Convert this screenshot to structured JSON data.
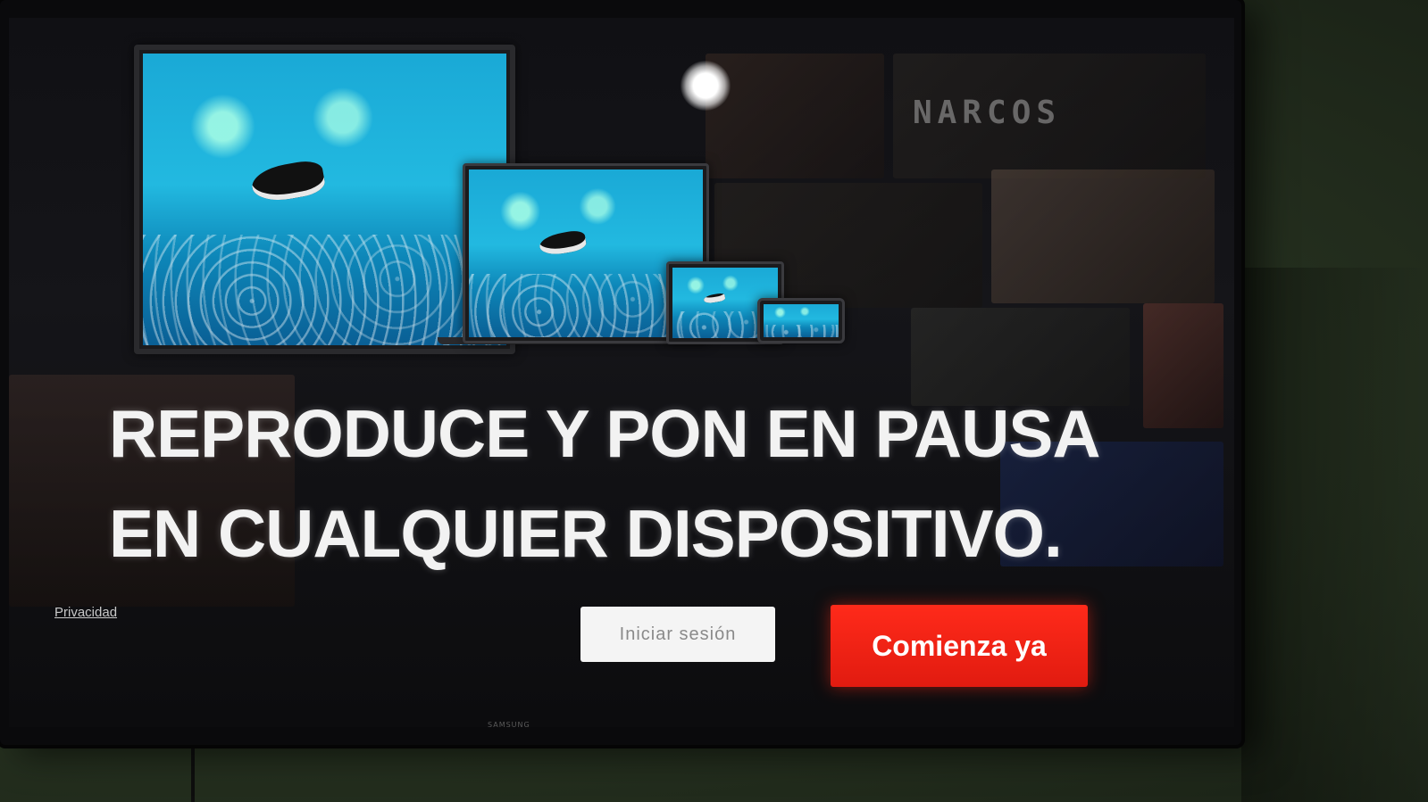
{
  "background_posters": {
    "narcos_title": "NARCOS"
  },
  "headline": {
    "line1": "REPRODUCE Y PON EN PAUSA",
    "line2": "EN CUALQUIER DISPOSITIVO."
  },
  "footer": {
    "privacy_link": "Privacidad",
    "signin_button": "Iniciar sesión",
    "start_button": "Comienza ya"
  },
  "tv_brand": "SAMSUNG",
  "colors": {
    "start_button": "#e11b10",
    "signin_button": "#f4f4f4",
    "headline_text": "#f2f2f2",
    "screen_background": "#101014"
  },
  "icons": {
    "devices_illustration": "tv-laptop-tablet-phone"
  }
}
